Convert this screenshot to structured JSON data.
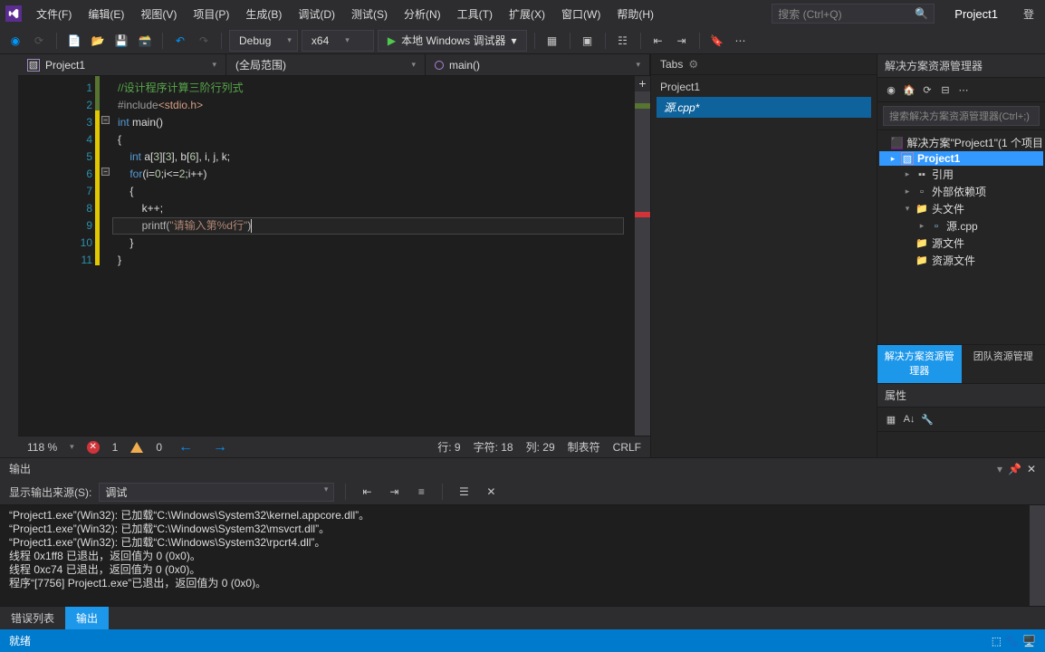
{
  "menubar": {
    "items": [
      "文件(F)",
      "编辑(E)",
      "视图(V)",
      "项目(P)",
      "生成(B)",
      "调试(D)",
      "测试(S)",
      "分析(N)",
      "工具(T)",
      "扩展(X)",
      "窗口(W)",
      "帮助(H)"
    ],
    "search_placeholder": "搜索 (Ctrl+Q)",
    "project_title": "Project1",
    "login": "登"
  },
  "toolbar": {
    "config": "Debug",
    "platform": "x64",
    "debug_label": "本地 Windows 调试器"
  },
  "editor": {
    "nav_project": "Project1",
    "nav_scope": "(全局范围)",
    "nav_func": "main()",
    "lines": [
      {
        "n": "1",
        "segs": [
          {
            "t": "//设计程序计算三阶行列式",
            "c": "c-comment"
          }
        ]
      },
      {
        "n": "2",
        "segs": [
          {
            "t": "#include",
            "c": "c-pp"
          },
          {
            "t": "<stdio.h>",
            "c": "c-inc"
          }
        ]
      },
      {
        "n": "3",
        "segs": [
          {
            "t": "int ",
            "c": "c-kw"
          },
          {
            "t": "main()",
            "c": ""
          }
        ]
      },
      {
        "n": "4",
        "segs": [
          {
            "t": "{",
            "c": ""
          }
        ]
      },
      {
        "n": "5",
        "segs": [
          {
            "t": "    ",
            "c": ""
          },
          {
            "t": "int ",
            "c": "c-kw"
          },
          {
            "t": "a[",
            "c": ""
          },
          {
            "t": "3",
            "c": "c-num"
          },
          {
            "t": "][",
            "c": ""
          },
          {
            "t": "3",
            "c": "c-num"
          },
          {
            "t": "], b[",
            "c": ""
          },
          {
            "t": "6",
            "c": "c-num"
          },
          {
            "t": "], i, j, k;",
            "c": ""
          }
        ]
      },
      {
        "n": "6",
        "segs": [
          {
            "t": "    ",
            "c": ""
          },
          {
            "t": "for",
            "c": "c-kw"
          },
          {
            "t": "(i=",
            "c": ""
          },
          {
            "t": "0",
            "c": "c-num"
          },
          {
            "t": ";i<=",
            "c": ""
          },
          {
            "t": "2",
            "c": "c-num"
          },
          {
            "t": ";i++)",
            "c": ""
          }
        ]
      },
      {
        "n": "7",
        "segs": [
          {
            "t": "    {",
            "c": ""
          }
        ]
      },
      {
        "n": "8",
        "segs": [
          {
            "t": "        k++;",
            "c": ""
          }
        ]
      },
      {
        "n": "9",
        "segs": [
          {
            "t": "        printf(",
            "c": ""
          },
          {
            "t": "\"请输入第%d行\"",
            "c": "c-str"
          },
          {
            "t": ")",
            "c": ""
          }
        ]
      },
      {
        "n": "10",
        "segs": [
          {
            "t": "    }",
            "c": ""
          }
        ]
      },
      {
        "n": "11",
        "segs": [
          {
            "t": "}",
            "c": ""
          }
        ]
      }
    ],
    "status": {
      "zoom": "118 %",
      "errors": "1",
      "warnings": "0",
      "line": "行: 9",
      "char": "字符: 18",
      "col": "列: 29",
      "tabs": "制表符",
      "eol": "CRLF"
    }
  },
  "tabs_panel": {
    "title": "Tabs",
    "project": "Project1",
    "file": "源.cpp*"
  },
  "explorer": {
    "title": "解决方案资源管理器",
    "search_placeholder": "搜索解决方案资源管理器(Ctrl+;)",
    "solution": "解决方案\"Project1\"(1 个项目",
    "project": "Project1",
    "refs": "引用",
    "ext": "外部依赖项",
    "hdr": "头文件",
    "src": "源.cpp",
    "src_folder": "源文件",
    "res": "资源文件",
    "tab_active": "解决方案资源管理器",
    "tab_other": "团队资源管理",
    "props": "属性"
  },
  "output": {
    "title": "输出",
    "from_label": "显示输出来源(S):",
    "from_value": "调试",
    "lines": [
      "“Project1.exe”(Win32): 已加载“C:\\Windows\\System32\\kernel.appcore.dll”。",
      "“Project1.exe”(Win32): 已加载“C:\\Windows\\System32\\msvcrt.dll”。",
      "“Project1.exe”(Win32): 已加载“C:\\Windows\\System32\\rpcrt4.dll”。",
      "线程 0x1ff8 已退出，返回值为 0 (0x0)。",
      "线程 0xc74 已退出，返回值为 0 (0x0)。",
      "程序“[7756] Project1.exe”已退出，返回值为 0 (0x0)。"
    ],
    "tab_err": "错误列表",
    "tab_out": "输出"
  },
  "statusbar": {
    "ready": "就绪"
  }
}
